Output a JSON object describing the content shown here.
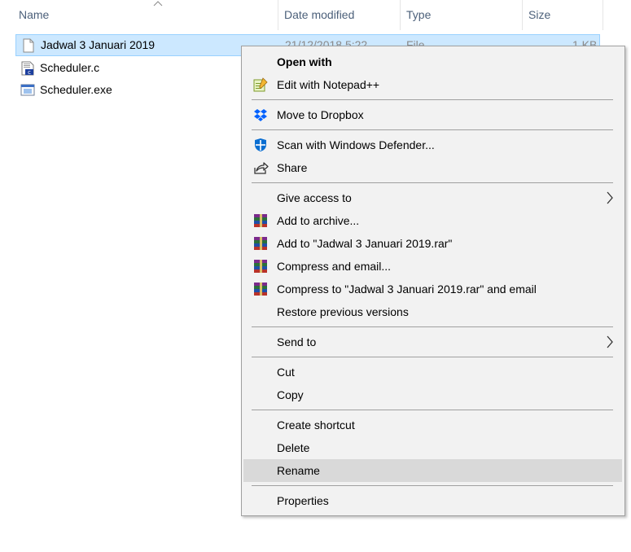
{
  "columns": {
    "name": "Name",
    "date_modified": "Date modified",
    "type": "Type",
    "size": "Size"
  },
  "files": [
    {
      "name": "Jadwal 3 Januari 2019",
      "date": "21/12/2018 5:22",
      "type": "File",
      "size": "1 KB",
      "icon": "blank-file-icon",
      "selected": true
    },
    {
      "name": "Scheduler.c",
      "icon": "c-source-file-icon",
      "selected": false
    },
    {
      "name": "Scheduler.exe",
      "icon": "exe-file-icon",
      "selected": false
    }
  ],
  "context_menu": {
    "items": [
      {
        "label": "Open with",
        "icon": null,
        "bold": true
      },
      {
        "label": "Edit with Notepad++",
        "icon": "notepadpp-icon"
      },
      {
        "label": "Move to Dropbox",
        "icon": "dropbox-icon"
      },
      {
        "label": "Scan with Windows Defender...",
        "icon": "windows-defender-icon"
      },
      {
        "label": "Share",
        "icon": "share-icon"
      },
      {
        "label": "Give access to",
        "icon": null,
        "submenu": true
      },
      {
        "label": "Add to archive...",
        "icon": "winrar-icon"
      },
      {
        "label": "Add to \"Jadwal 3 Januari 2019.rar\"",
        "icon": "winrar-icon"
      },
      {
        "label": "Compress and email...",
        "icon": "winrar-icon"
      },
      {
        "label": "Compress to \"Jadwal 3 Januari 2019.rar\" and email",
        "icon": "winrar-icon"
      },
      {
        "label": "Restore previous versions",
        "icon": null
      },
      {
        "label": "Send to",
        "icon": null,
        "submenu": true
      },
      {
        "label": "Cut",
        "icon": null
      },
      {
        "label": "Copy",
        "icon": null
      },
      {
        "label": "Create shortcut",
        "icon": null
      },
      {
        "label": "Delete",
        "icon": null
      },
      {
        "label": "Rename",
        "icon": null,
        "hovered": true
      },
      {
        "label": "Properties",
        "icon": null
      }
    ]
  },
  "colors": {
    "selection_bg": "#cce8ff",
    "selection_border": "#99d1ff",
    "menu_bg": "#f2f2f2",
    "menu_hover": "#d9d9d9",
    "header_text": "#4c607a"
  }
}
